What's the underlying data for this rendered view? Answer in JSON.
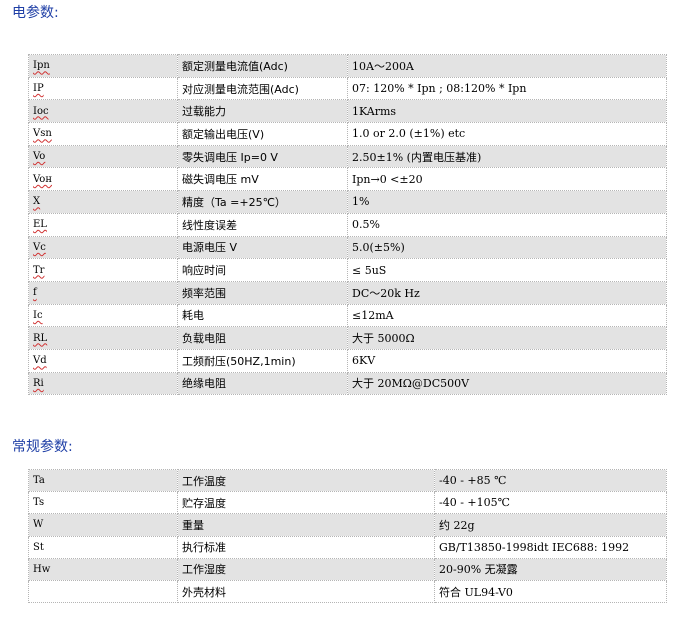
{
  "sections": {
    "electrical_title": "电参数:",
    "general_title": "常规参数:"
  },
  "electrical": [
    {
      "sym": "Ipn",
      "name": "额定测量电流值(Adc)",
      "val": "10A～200A"
    },
    {
      "sym": "IP",
      "name": "对应测量电流范围(Adc)",
      "val": "07: 120% * Ipn ;            08:120% * Ipn"
    },
    {
      "sym": "Ioc",
      "name": "过载能力",
      "val": "1KArms"
    },
    {
      "sym": "Vsn",
      "name": "额定输出电压(V)",
      "val": "1.0   or   2.0 (±1%)  etc"
    },
    {
      "sym": "Vo",
      "name": "零失调电压  Ip=0    V",
      "val": "2.50±1%   (内置电压基准)"
    },
    {
      "sym": "Voн",
      "name": "磁失调电压   mV",
      "val": "Ipn→0                          <±20"
    },
    {
      "sym": "X",
      "name": "精度（Ta =+25℃）",
      "val": "1%"
    },
    {
      "sym": "EL",
      "name": "线性度误差",
      "val": "0.5%"
    },
    {
      "sym": "Vc",
      "name": "电源电压   V",
      "val": "5.0(±5%)"
    },
    {
      "sym": "Tr",
      "name": "响应时间",
      "val": "≤ 5uS"
    },
    {
      "sym": "f",
      "name": "频率范围",
      "val": "DC～20k Hz"
    },
    {
      "sym": "Ic",
      "name": "耗电",
      "val": "≤12mA"
    },
    {
      "sym": "RL",
      "name": "负载电阻",
      "val": "大于 5000Ω"
    },
    {
      "sym": "Vd",
      "name": "工频耐压(50HZ,1min)",
      "val": "6KV"
    },
    {
      "sym": "Ri",
      "name": "绝缘电阻",
      "val": "大于 20MΩ@DC500V"
    }
  ],
  "general": [
    {
      "sym": "Ta",
      "name": "工作温度",
      "val": "-40 - +85 ℃"
    },
    {
      "sym": "Ts",
      "name": "贮存温度",
      "val": "-40 - +105℃"
    },
    {
      "sym": "W",
      "name": "重量",
      "val": "约 22g"
    },
    {
      "sym": "St",
      "name": "执行标准",
      "val": "GB/T13850-1998idt IEC688: 1992"
    },
    {
      "sym": "Hw",
      "name": "工作湿度",
      "val": "20-90% 无凝露"
    },
    {
      "sym": "",
      "name": "外壳材料",
      "val": "符合 UL94-V0"
    }
  ]
}
